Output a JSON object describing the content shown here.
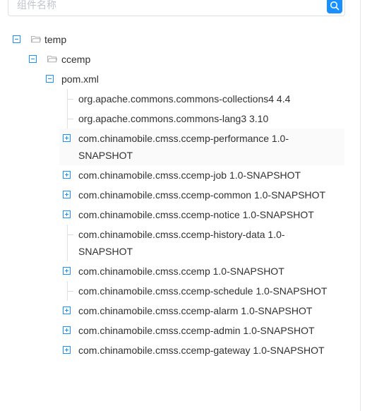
{
  "search": {
    "placeholder": "组件名称"
  },
  "tree": {
    "root": {
      "label": "temp"
    },
    "child": {
      "label": "ccemp"
    },
    "pom": {
      "label": "pom.xml"
    },
    "deps": [
      {
        "label": "org.apache.commons.commons-collections4 4.4",
        "expandable": false
      },
      {
        "label": "org.apache.commons.commons-lang3 3.10",
        "expandable": false
      },
      {
        "label": "com.chinamobile.cmss.ccemp-performance 1.0-SNAPSHOT",
        "expandable": true
      },
      {
        "label": "com.chinamobile.cmss.ccemp-job 1.0-SNAPSHOT",
        "expandable": true
      },
      {
        "label": "com.chinamobile.cmss.ccemp-common 1.0-SNAPSHOT",
        "expandable": true
      },
      {
        "label": "com.chinamobile.cmss.ccemp-notice 1.0-SNAPSHOT",
        "expandable": true
      },
      {
        "label": "com.chinamobile.cmss.ccemp-history-data 1.0-SNAPSHOT",
        "expandable": false
      },
      {
        "label": "com.chinamobile.cmss.ccemp 1.0-SNAPSHOT",
        "expandable": true
      },
      {
        "label": "com.chinamobile.cmss.ccemp-schedule 1.0-SNAPSHOT",
        "expandable": false
      },
      {
        "label": "com.chinamobile.cmss.ccemp-alarm 1.0-SNAPSHOT",
        "expandable": true
      },
      {
        "label": "com.chinamobile.cmss.ccemp-admin 1.0-SNAPSHOT",
        "expandable": true
      },
      {
        "label": "com.chinamobile.cmss.ccemp-gateway 1.0-SNAPSHOT",
        "expandable": true
      }
    ]
  },
  "colors": {
    "accent": "#1890ff",
    "text": "#303133",
    "border": "#dcdfe6"
  }
}
